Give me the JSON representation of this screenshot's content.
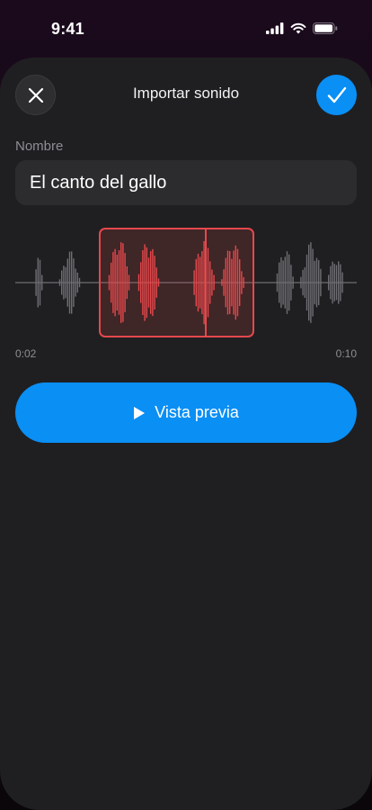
{
  "status": {
    "time": "9:41"
  },
  "header": {
    "title": "Importar sonido"
  },
  "name_field": {
    "label": "Nombre",
    "value": "El canto del gallo"
  },
  "trim": {
    "start_label": "0:02",
    "end_label": "0:10"
  },
  "preview": {
    "label": "Vista previa"
  },
  "colors": {
    "accent": "#0A8FF5",
    "selection": "#E5484D",
    "waveform_inactive": "#6E6E73"
  }
}
